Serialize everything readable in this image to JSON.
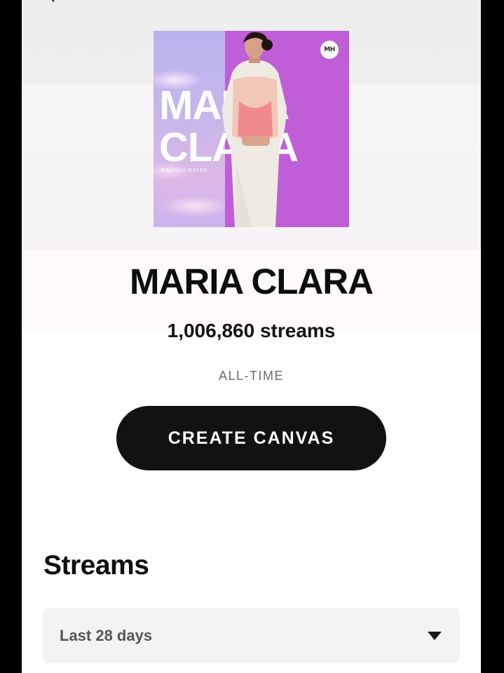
{
  "nav": {
    "back_icon": "back-arrow-icon"
  },
  "cover": {
    "word_1": "MARIA",
    "word_2": "CLARA",
    "artist": "MAGNUS HAVEN",
    "logo": "MH",
    "colors": {
      "left": "#c7b6ea",
      "right": "#c05ed8"
    }
  },
  "song": {
    "title": "MARIA CLARA",
    "streams": "1,006,860 streams",
    "period": "ALL-TIME"
  },
  "actions": {
    "create_canvas_label": "CREATE CANVAS"
  },
  "streams_section": {
    "heading": "Streams",
    "range": {
      "selected": "Last 28 days",
      "icon": "chevron-down-icon"
    }
  },
  "colors": {
    "button_bg": "#121212",
    "select_bg": "#f3f3f3",
    "text_primary": "#0d0d0d",
    "text_muted": "#6a6a6a"
  }
}
